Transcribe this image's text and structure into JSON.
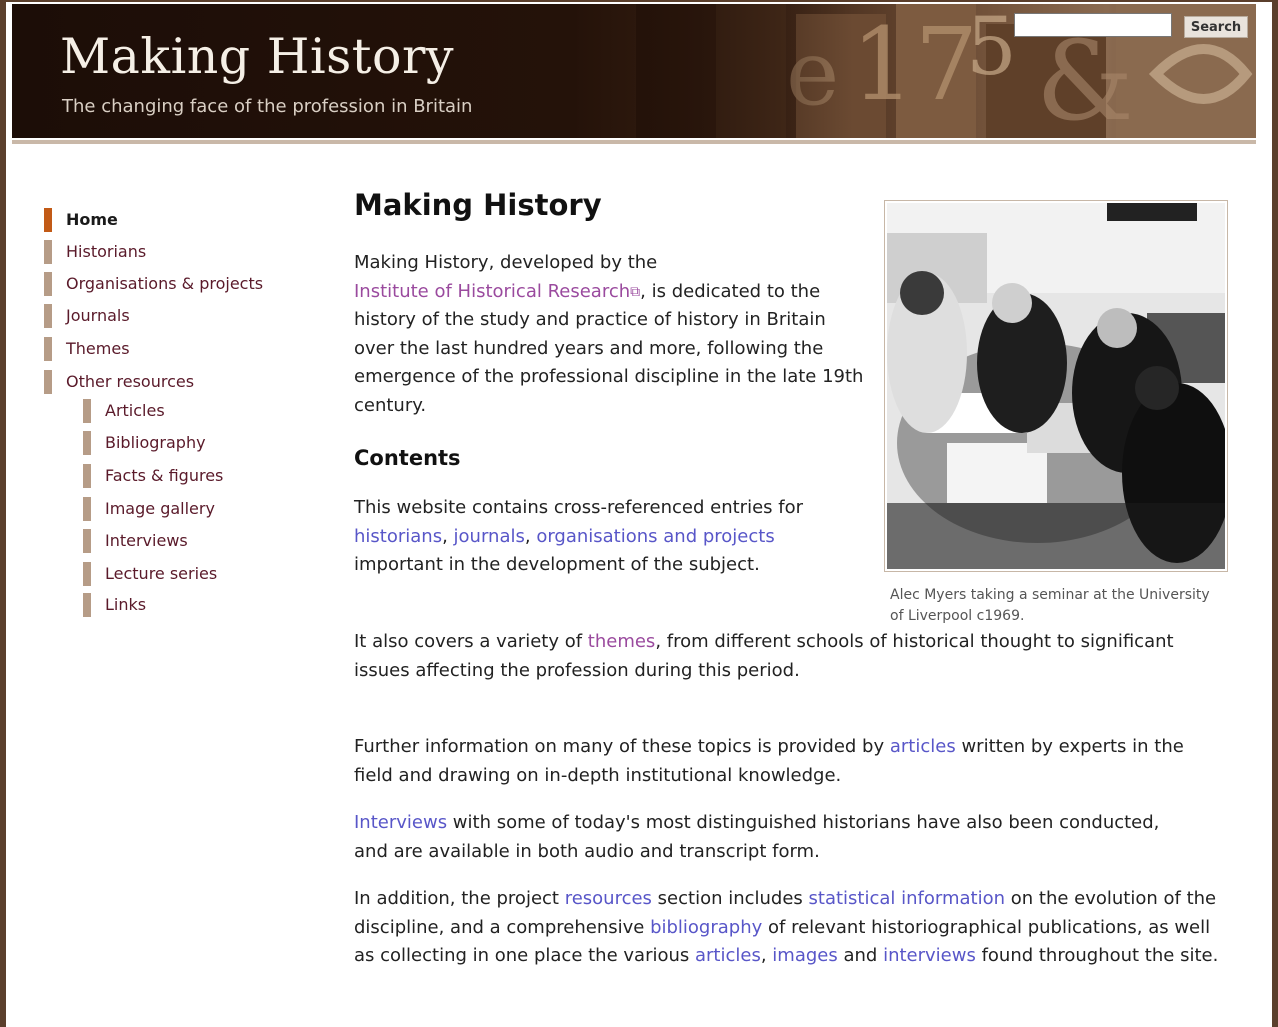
{
  "header": {
    "title": "Making History",
    "tagline": "The changing face of the profession in Britain",
    "search_placeholder": "",
    "search_button": "Search"
  },
  "nav": {
    "items": [
      {
        "label": "Home",
        "active": true
      },
      {
        "label": "Historians"
      },
      {
        "label": "Organisations & projects"
      },
      {
        "label": "Journals"
      },
      {
        "label": "Themes"
      },
      {
        "label": "Other resources"
      }
    ],
    "sub_items": [
      {
        "label": "Articles"
      },
      {
        "label": "Bibliography"
      },
      {
        "label": "Facts & figures"
      },
      {
        "label": "Image gallery"
      },
      {
        "label": "Interviews"
      },
      {
        "label": "Lecture series"
      },
      {
        "label": "Links"
      }
    ]
  },
  "main": {
    "heading": "Making History",
    "intro": {
      "t1": "Making History, developed by the",
      "link_ihr": "Institute of Historical Research",
      "t2": ", is dedicated to the history of the study and practice of history in Britain over the last hundred years and more, following the emergence of the professional discipline in the late 19th century."
    },
    "contents_heading": "Contents",
    "p1": {
      "t1": "This website contains cross-referenced entries for ",
      "link_historians": "historians",
      "t2": ", ",
      "link_journals": "journals",
      "t3": ", ",
      "link_orgs": "organisations and projects",
      "t4": " important in the development of the subject."
    },
    "p2": {
      "t1": "It also covers a variety of ",
      "link_themes": "themes",
      "t2": ", from different schools of historical thought to significant issues affecting the profession during this period."
    },
    "p3": {
      "t1": "Further information on many of these topics is provided by ",
      "link_articles": "articles",
      "t2": " written by experts in the field and drawing on in-depth institutional knowledge."
    },
    "p4": {
      "link_interviews": "Interviews",
      "t1": " with some of today's most distinguished historians have also been conducted, and are available in both audio and transcript form."
    },
    "p5": {
      "t1": "In addition, the project ",
      "link_resources": "resources",
      "t2": " section includes ",
      "link_stats": "statistical information",
      "t3": " on the evolution of the discipline, and a comprehensive ",
      "link_biblio": "bibliography",
      "t4": " of relevant historiographical publications, as well as collecting in one place the various ",
      "link_articles": "articles",
      "t5": ", ",
      "link_images": "images",
      "t6": " and ",
      "link_interviews": "interviews",
      "t7": " found throughout the site."
    }
  },
  "photo": {
    "caption": "Alec Myers taking a seminar at the University of Liverpool c1969."
  },
  "colors": {
    "frame": "#5b3f2c",
    "link": "#5856c8",
    "visited_link": "#9a4a9e",
    "nav_text": "#5a1a2a",
    "nav_bar": "#b69c87",
    "nav_active_bar": "#c25a16"
  }
}
